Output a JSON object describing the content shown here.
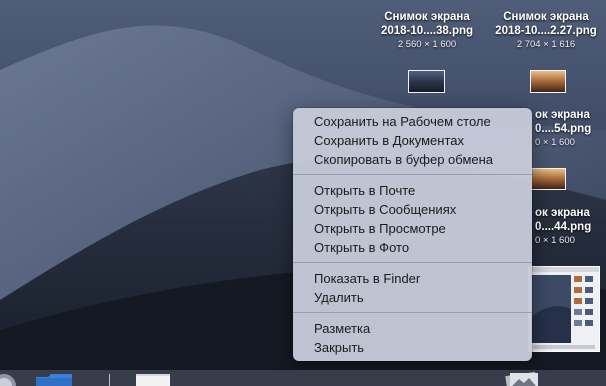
{
  "desktop": {
    "files": [
      {
        "name_line1": "Снимок экрана",
        "name_line2": "2018-10....38.png",
        "dimensions": "2 560 × 1 600",
        "thumb": "dark"
      },
      {
        "name_line1": "Снимок экрана",
        "name_line2": "2018-10....2.27.png",
        "dimensions": "2 704 × 1 616",
        "thumb": "warm"
      },
      {
        "name_line1": "ок экрана",
        "name_line2": "0....54.png",
        "dimensions": "0 × 1 600",
        "thumb": "warm"
      },
      {
        "name_line1": "ок экрана",
        "name_line2": "0....44.png",
        "dimensions": "0 × 1 600",
        "thumb": "dark"
      }
    ]
  },
  "context_menu": {
    "groups": [
      [
        "Сохранить на Рабочем столе",
        "Сохранить в Документах",
        "Скопировать в буфер обмена"
      ],
      [
        "Открыть в Почте",
        "Открыть в Сообщениях",
        "Открыть в Просмотре",
        "Открыть в Фото"
      ],
      [
        "Показать в Finder",
        "Удалить"
      ],
      [
        "Разметка",
        "Закрыть"
      ]
    ]
  },
  "colors": {
    "menu_background": "#c6cad8",
    "menu_text": "#1b1b1d",
    "label_text": "#ffffff"
  },
  "dock": {
    "icons": [
      "dock-app-icon-left",
      "dock-folder-icon",
      "dock-document-icon",
      "dock-photos-icon"
    ]
  }
}
